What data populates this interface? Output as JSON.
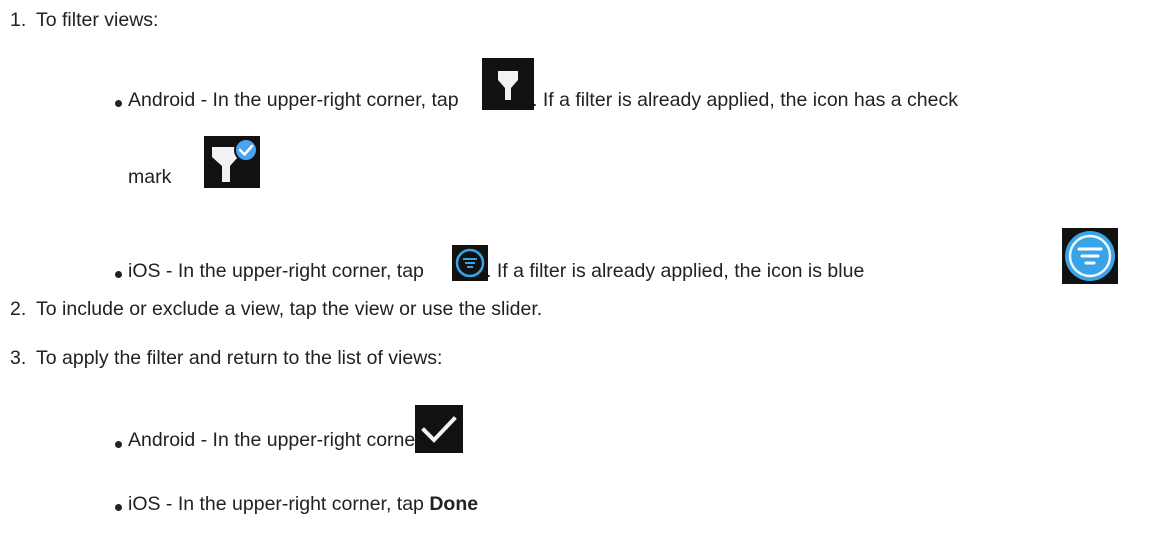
{
  "steps": [
    {
      "number": "1.",
      "text": "To filter views:",
      "items": [
        {
          "platform_prefix": "Android - In the upper-right corner, tap",
          "icon": "filter-icon",
          "after_icon": ". If a filter is already applied, the icon has a check",
          "line2": "mark",
          "icon2": "filter-checked-icon"
        },
        {
          "platform_prefix": "iOS - In the upper-right corner, tap",
          "icon": "ios-filter-icon",
          "after_icon": ". If a filter is already applied, the icon is blue",
          "icon2": "ios-filter-blue-icon"
        }
      ]
    },
    {
      "number": "2.",
      "text": "To include or exclude a view, tap the view or use the slider."
    },
    {
      "number": "3.",
      "text": "To apply the filter and return to the list of views:",
      "items": [
        {
          "platform_prefix": "Android - In the upper-right corner, tap",
          "icon": "checkmark-icon"
        },
        {
          "platform_prefix": "iOS - In the upper-right corner, tap",
          "bold": "Done"
        }
      ]
    }
  ],
  "colors": {
    "text": "#222222",
    "icon_bg": "#111111",
    "ios_blue": "#3aa3e8"
  }
}
